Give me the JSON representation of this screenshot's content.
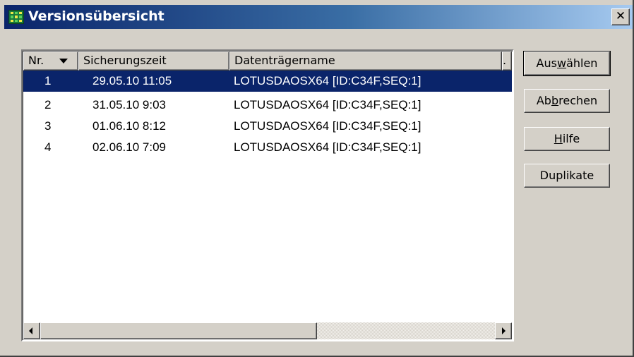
{
  "window": {
    "title": "Versionsübersicht",
    "close_label": "✕"
  },
  "list": {
    "columns": [
      {
        "label": "Nr."
      },
      {
        "label": "Sicherungszeit"
      },
      {
        "label": "Datenträgername"
      },
      {
        "label": "."
      }
    ],
    "rows": [
      {
        "nr": "1",
        "time": "29.05.10 11:05",
        "name": "LOTUSDAOSX64 [ID:C34F,SEQ:1]",
        "selected": true
      },
      {
        "nr": "2",
        "time": "31.05.10 9:03",
        "name": "LOTUSDAOSX64 [ID:C34F,SEQ:1]"
      },
      {
        "nr": "3",
        "time": "01.06.10 8:12",
        "name": "LOTUSDAOSX64 [ID:C34F,SEQ:1]"
      },
      {
        "nr": "4",
        "time": "02.06.10 7:09",
        "name": "LOTUSDAOSX64 [ID:C34F,SEQ:1]"
      }
    ]
  },
  "buttons": {
    "select": {
      "pre": "Aus",
      "key": "w",
      "post": "ählen"
    },
    "cancel": {
      "pre": "Ab",
      "key": "b",
      "post": "rechen"
    },
    "help": {
      "pre": "",
      "key": "H",
      "post": "ilfe"
    },
    "duplicates": {
      "label": "Duplikate"
    }
  },
  "colors": {
    "selection": "#0a246a",
    "dialog_face": "#d4d0c8",
    "titlebar_start": "#0a246a",
    "titlebar_end": "#a6caf0"
  }
}
